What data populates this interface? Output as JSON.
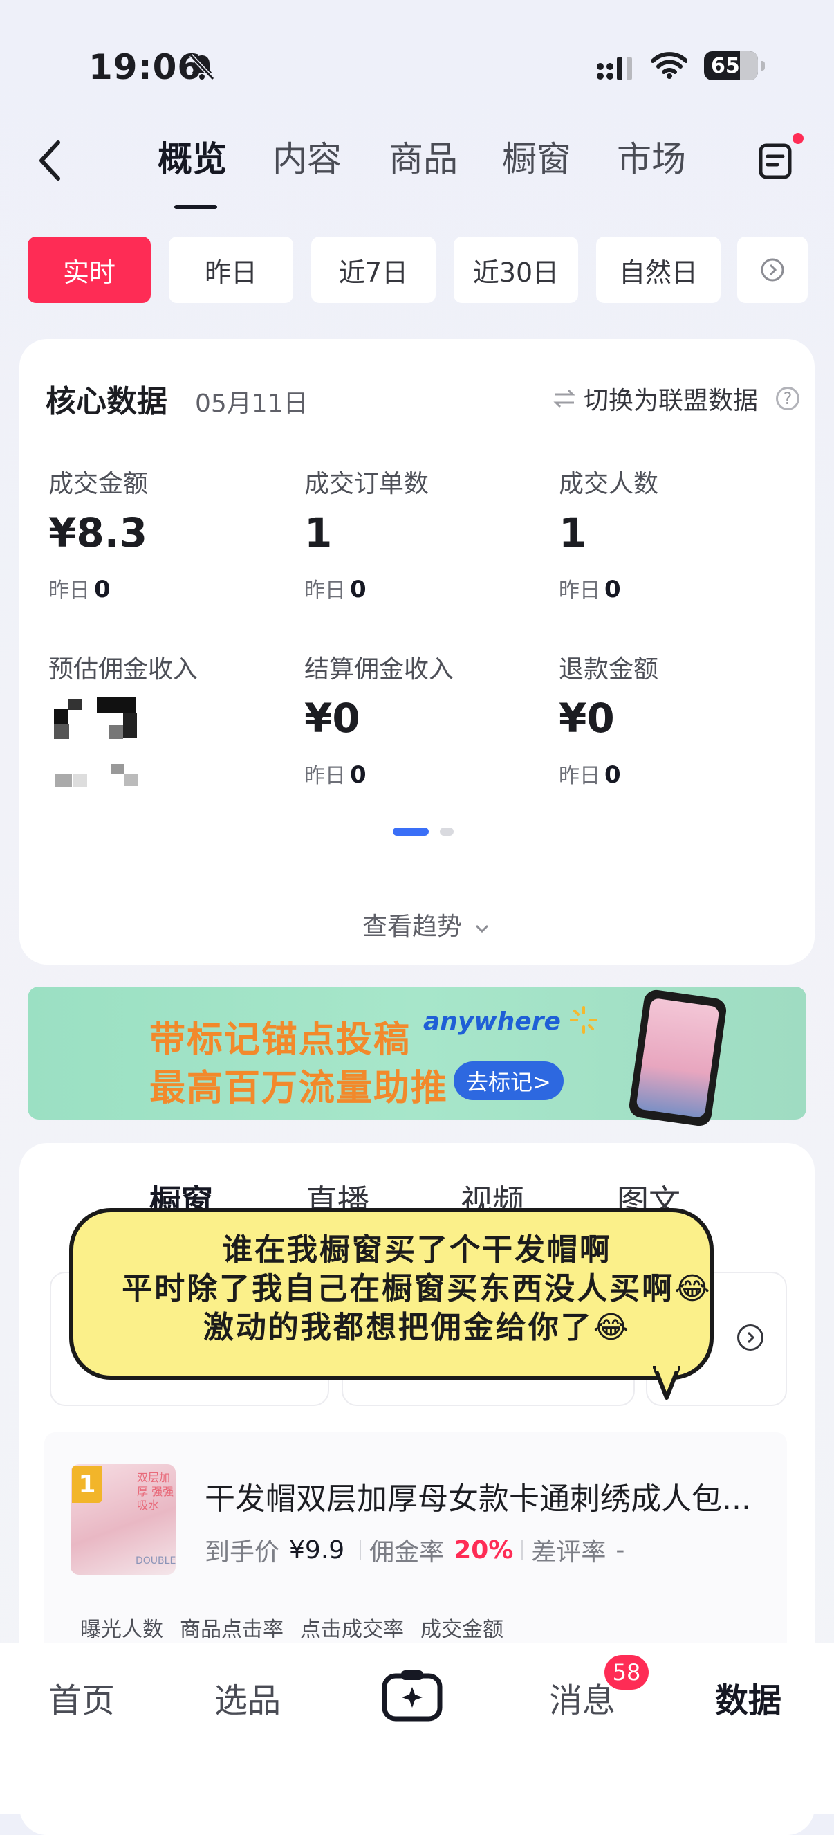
{
  "status_bar": {
    "time": "19:06",
    "battery": "65"
  },
  "nav": {
    "tabs": [
      "概览",
      "内容",
      "商品",
      "橱窗",
      "市场"
    ],
    "active_tab": "概览"
  },
  "periods": [
    "实时",
    "昨日",
    "近7日",
    "近30日",
    "自然日"
  ],
  "core": {
    "title": "核心数据",
    "date": "05月11日",
    "switch_label": "切换为联盟数据",
    "help": "?",
    "metrics": [
      {
        "label": "成交金额",
        "value": "¥8.3",
        "yesterday_label": "昨日",
        "yesterday_value": "0"
      },
      {
        "label": "成交订单数",
        "value": "1",
        "yesterday_label": "昨日",
        "yesterday_value": "0"
      },
      {
        "label": "成交人数",
        "value": "1",
        "yesterday_label": "昨日",
        "yesterday_value": "0"
      },
      {
        "label": "预估佣金收入",
        "value": "",
        "yesterday_label": "",
        "yesterday_value": ""
      },
      {
        "label": "结算佣金收入",
        "value": "¥0",
        "yesterday_label": "昨日",
        "yesterday_value": "0"
      },
      {
        "label": "退款金额",
        "value": "¥0",
        "yesterday_label": "昨日",
        "yesterday_value": "0"
      }
    ],
    "trend_label": "查看趋势"
  },
  "banner": {
    "line1": "带标记锚点投稿",
    "line2": "最高百万流量助推",
    "brand": "anywhere",
    "button": "去标记>"
  },
  "subtabs": [
    "橱窗",
    "直播",
    "视频",
    "图文"
  ],
  "bubble": {
    "lines": [
      "谁在我橱窗买了个干发帽啊",
      "平时除了我自己在橱窗买东西没人买啊😂",
      "激动的我都想把佣金给你了😂"
    ]
  },
  "product": {
    "rank": "1",
    "image_tag": "双层加厚 强强吸水",
    "image_brand": "DOUBLE",
    "title": "干发帽双层加厚母女款卡通刺绣成人包...",
    "price_label": "到手价",
    "price": "¥9.9",
    "commission_label": "佣金率",
    "commission": "20%",
    "bad_review_label": "差评率",
    "bad_review": "-",
    "metric_labels": [
      "曝光人数",
      "商品点击率",
      "点击成交率",
      "成交金额"
    ]
  },
  "bottom_nav": {
    "items": [
      "首页",
      "选品",
      "消息",
      "数据"
    ],
    "active": "数据",
    "message_badge": "58"
  },
  "colors": {
    "accent": "#fe2c55",
    "indicator": "#3a6ff7",
    "banner_text": "#f2892b"
  }
}
